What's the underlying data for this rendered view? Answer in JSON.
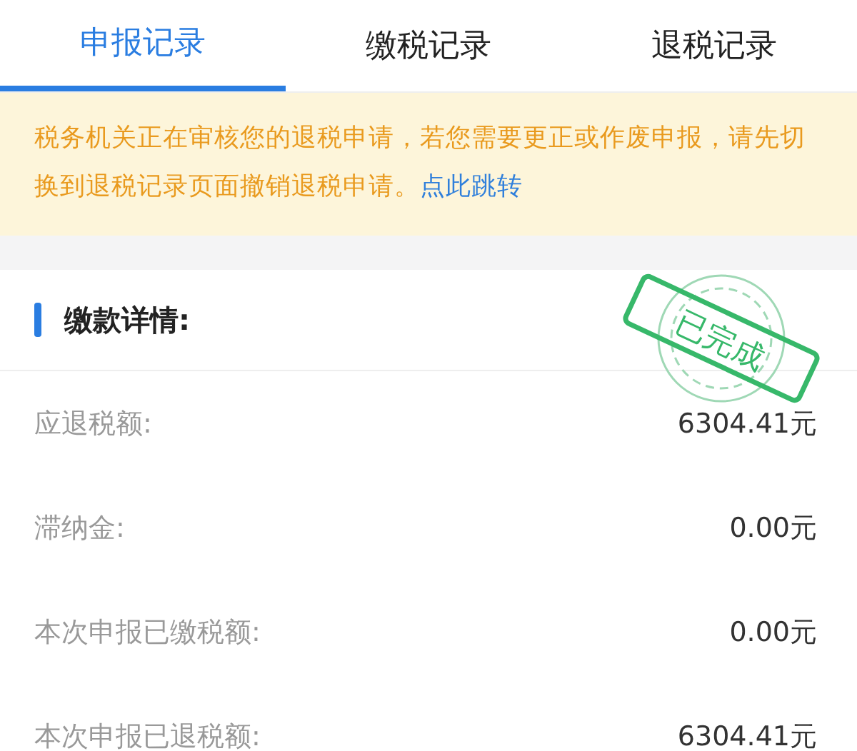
{
  "tabs": [
    {
      "label": "申报记录",
      "selected": true
    },
    {
      "label": "缴税记录",
      "selected": false
    },
    {
      "label": "退税记录",
      "selected": false
    }
  ],
  "notice": {
    "text": "税务机关正在审核您的退税申请，若您需要更正或作废申报，请先切换到退税记录页面撤销退税申请。",
    "link": "点此跳转"
  },
  "section": {
    "title": "缴款详情:"
  },
  "rows": [
    {
      "label": "应退税额:",
      "value": "6304.41元"
    },
    {
      "label": "滞纳金:",
      "value": "0.00元"
    },
    {
      "label": "本次申报已缴税额:",
      "value": "0.00元"
    },
    {
      "label": "本次申报已退税额:",
      "value": "6304.41元"
    }
  ],
  "stamp": {
    "text": "已完成"
  }
}
